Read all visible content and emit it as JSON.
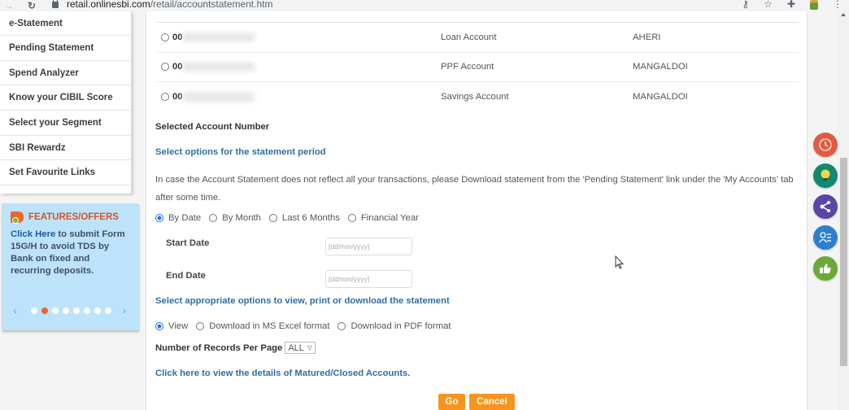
{
  "browser": {
    "url_host": "retail.onlinesbi.com",
    "url_path": "/retail/accountstatement.htm",
    "back_icon": "arrow-right-icon",
    "reload_icon": "reload-icon",
    "toolbar_icons": [
      "key-icon",
      "star-icon",
      "extensions-puzzle-icon",
      "profile-avatar-icon",
      "menu-kebab-icon"
    ]
  },
  "sidebar": {
    "items": [
      {
        "label": "e-Statement"
      },
      {
        "label": "Pending Statement"
      },
      {
        "label": "Spend Analyzer"
      },
      {
        "label": "Know your CIBIL Score"
      },
      {
        "label": "Select your Segment"
      },
      {
        "label": "SBI Rewardz"
      },
      {
        "label": "Set Favourite Links"
      }
    ],
    "features": {
      "title": "FEATURES/OFFERS",
      "link_text": "Click Here",
      "body_text": " to submit Form 15G/H to avoid TDS by Bank on fixed and recurring deposits.",
      "carousel_prev": "‹",
      "carousel_next": "›",
      "dot_count": 8,
      "active_dot": 2,
      "accent_color": "#e8672b"
    }
  },
  "accounts": [
    {
      "number_prefix": "00",
      "type": "Loan Account",
      "branch": "AHERI",
      "selected": false
    },
    {
      "number_prefix": "00",
      "type": "PPF Account",
      "branch": "MANGALDOI",
      "selected": false
    },
    {
      "number_prefix": "00",
      "type": "Savings Account",
      "branch": "MANGALDOI",
      "selected": false
    }
  ],
  "form": {
    "selected_account_label": "Selected Account Number",
    "period_heading": "Select options for the statement period",
    "note": "In case the Account Statement does not reflect all your transactions, please Download statement from the 'Pending Statement' link under the 'My Accounts' tab after some time.",
    "period_options": [
      {
        "label": "By Date",
        "checked": true
      },
      {
        "label": "By Month",
        "checked": false
      },
      {
        "label": "Last 6 Months",
        "checked": false
      },
      {
        "label": "Financial Year",
        "checked": false
      }
    ],
    "start_date_label": "Start Date",
    "start_date_placeholder": "[dd/mm/yyyy]",
    "start_date_value": "",
    "end_date_label": "End Date",
    "end_date_placeholder": "[dd/mm/yyyy]",
    "end_date_value": "",
    "output_heading": "Select appropriate options to view, print or download the statement",
    "output_options": [
      {
        "label": "View",
        "checked": true
      },
      {
        "label": "Download in MS Excel format",
        "checked": false
      },
      {
        "label": "Download in PDF format",
        "checked": false
      }
    ],
    "records_label": "Number of Records Per Page",
    "records_value": "ALL",
    "closed_accounts_link": "Click here to view the details of Matured/Closed Accounts.",
    "go_label": "Go",
    "cancel_label": "Cancel",
    "button_color": "#f7941d",
    "link_color": "#2f6ea5"
  },
  "float_icons": [
    {
      "name": "history-clock-icon",
      "color": "#e05a47"
    },
    {
      "name": "lightbulb-icon",
      "color": "#0f8a6e"
    },
    {
      "name": "share-icon",
      "color": "#5a46a8"
    },
    {
      "name": "user-list-icon",
      "color": "#2f7fcf"
    },
    {
      "name": "thumbs-up-icon",
      "color": "#6aaa38"
    }
  ]
}
